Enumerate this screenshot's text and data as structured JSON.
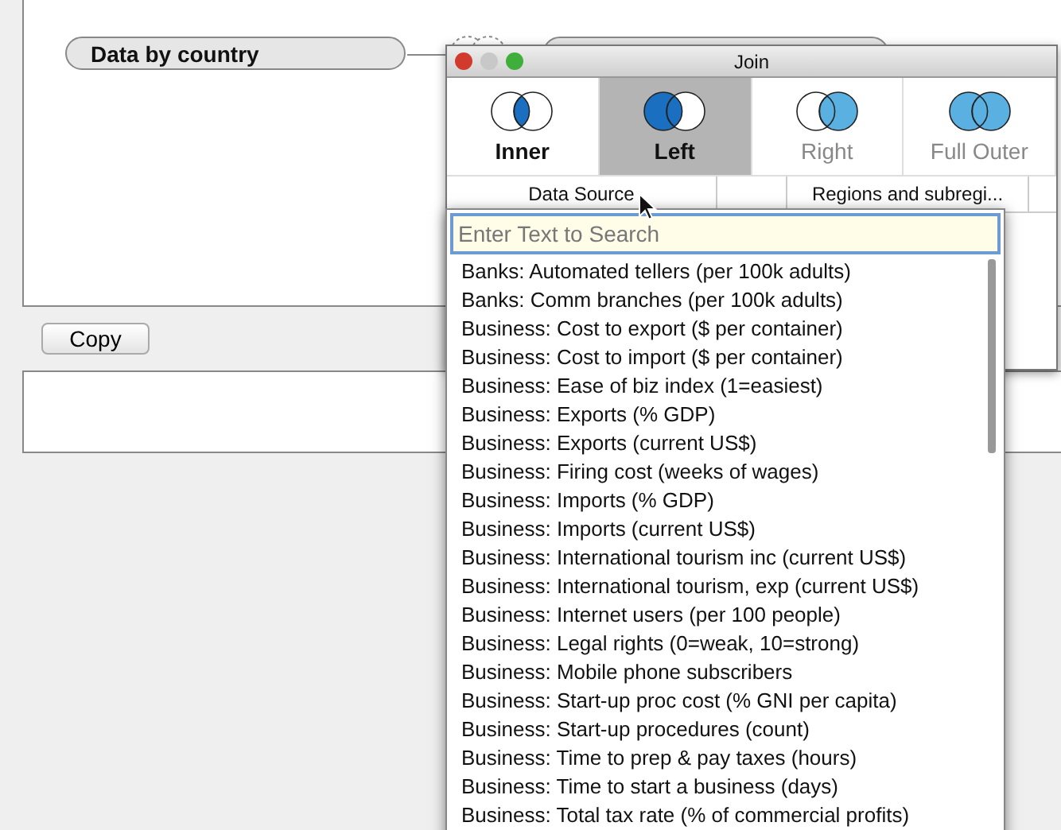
{
  "canvas": {
    "left_source": "Data by country"
  },
  "copy_button": "Copy",
  "join_dialog": {
    "title": "Join",
    "join_types": [
      {
        "label": "Inner",
        "kind": "inner",
        "selected": false,
        "disabled": false
      },
      {
        "label": "Left",
        "kind": "left",
        "selected": true,
        "disabled": false
      },
      {
        "label": "Right",
        "kind": "right",
        "selected": false,
        "disabled": true
      },
      {
        "label": "Full Outer",
        "kind": "full",
        "selected": false,
        "disabled": true
      }
    ],
    "columns": [
      "Data Source",
      "",
      "Regions and subregi..."
    ]
  },
  "field_dropdown": {
    "search": {
      "placeholder": "Enter Text to Search"
    },
    "items": [
      "Banks: Automated tellers (per 100k adults)",
      "Banks: Comm branches (per 100k adults)",
      "Business: Cost to export ($ per container)",
      "Business: Cost to import ($ per container)",
      "Business: Ease of biz index (1=easiest)",
      "Business: Exports (% GDP)",
      "Business: Exports (current US$)",
      "Business: Firing cost (weeks of wages)",
      "Business: Imports (% GDP)",
      "Business: Imports (current US$)",
      "Business: International tourism inc (current US$)",
      "Business: International tourism, exp (current US$)",
      "Business: Internet users (per 100 people)",
      "Business: Legal rights (0=weak, 10=strong)",
      "Business: Mobile phone subscribers",
      "Business: Start-up proc cost (% GNI per capita)",
      "Business: Start-up procedures (count)",
      "Business: Time to prep & pay taxes (hours)",
      "Business: Time to start a business (days)",
      "Business: Total tax rate (% of commercial profits)"
    ]
  }
}
